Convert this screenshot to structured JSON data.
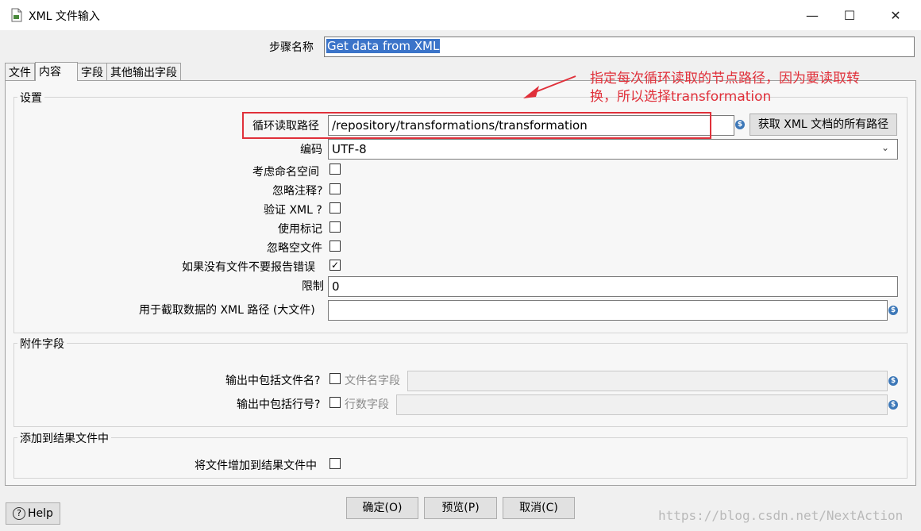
{
  "window": {
    "title": "XML 文件输入",
    "minimize": "—",
    "maximize": "☐",
    "close": "✕"
  },
  "step_name": {
    "label": "步骤名称",
    "value": "Get data from XML"
  },
  "tabs": [
    {
      "label": "文件",
      "active": false
    },
    {
      "label": "内容",
      "active": true
    },
    {
      "label": "字段",
      "active": false
    },
    {
      "label": "其他输出字段",
      "active": false
    }
  ],
  "settings": {
    "title": "设置",
    "loop_path_label": "循环读取路径",
    "loop_path_value": "/repository/transformations/transformation",
    "get_paths_button": "获取 XML 文档的所有路径",
    "encoding_label": "编码",
    "encoding_value": "UTF-8",
    "namespace_label": "考虑命名空间",
    "ignore_comments_label": "忽略注释?",
    "validate_xml_label": "验证 XML ?",
    "use_token_label": "使用标记",
    "ignore_empty_label": "忽略空文件",
    "no_file_error_label": "如果没有文件不要报告错误",
    "no_file_error_checked": true,
    "limit_label": "限制",
    "limit_value": "0",
    "prune_path_label": "用于截取数据的 XML 路径 (大文件)",
    "prune_path_value": ""
  },
  "additional_fields": {
    "title": "附件字段",
    "include_filename_label": "输出中包括文件名?",
    "filename_field_label": "文件名字段",
    "include_rownum_label": "输出中包括行号?",
    "rownum_field_label": "行数字段"
  },
  "result_files": {
    "title": "添加到结果文件中",
    "add_label": "将文件增加到结果文件中"
  },
  "buttons": {
    "help": "Help",
    "ok": "确定(O)",
    "preview": "预览(P)",
    "cancel": "取消(C)"
  },
  "annotation": {
    "line1": "指定每次循环读取的节点路径，因为要读取转",
    "line2": "换，所以选择transformation",
    "color": "#e0303a"
  },
  "watermark": "https://blog.csdn.net/NextAction"
}
